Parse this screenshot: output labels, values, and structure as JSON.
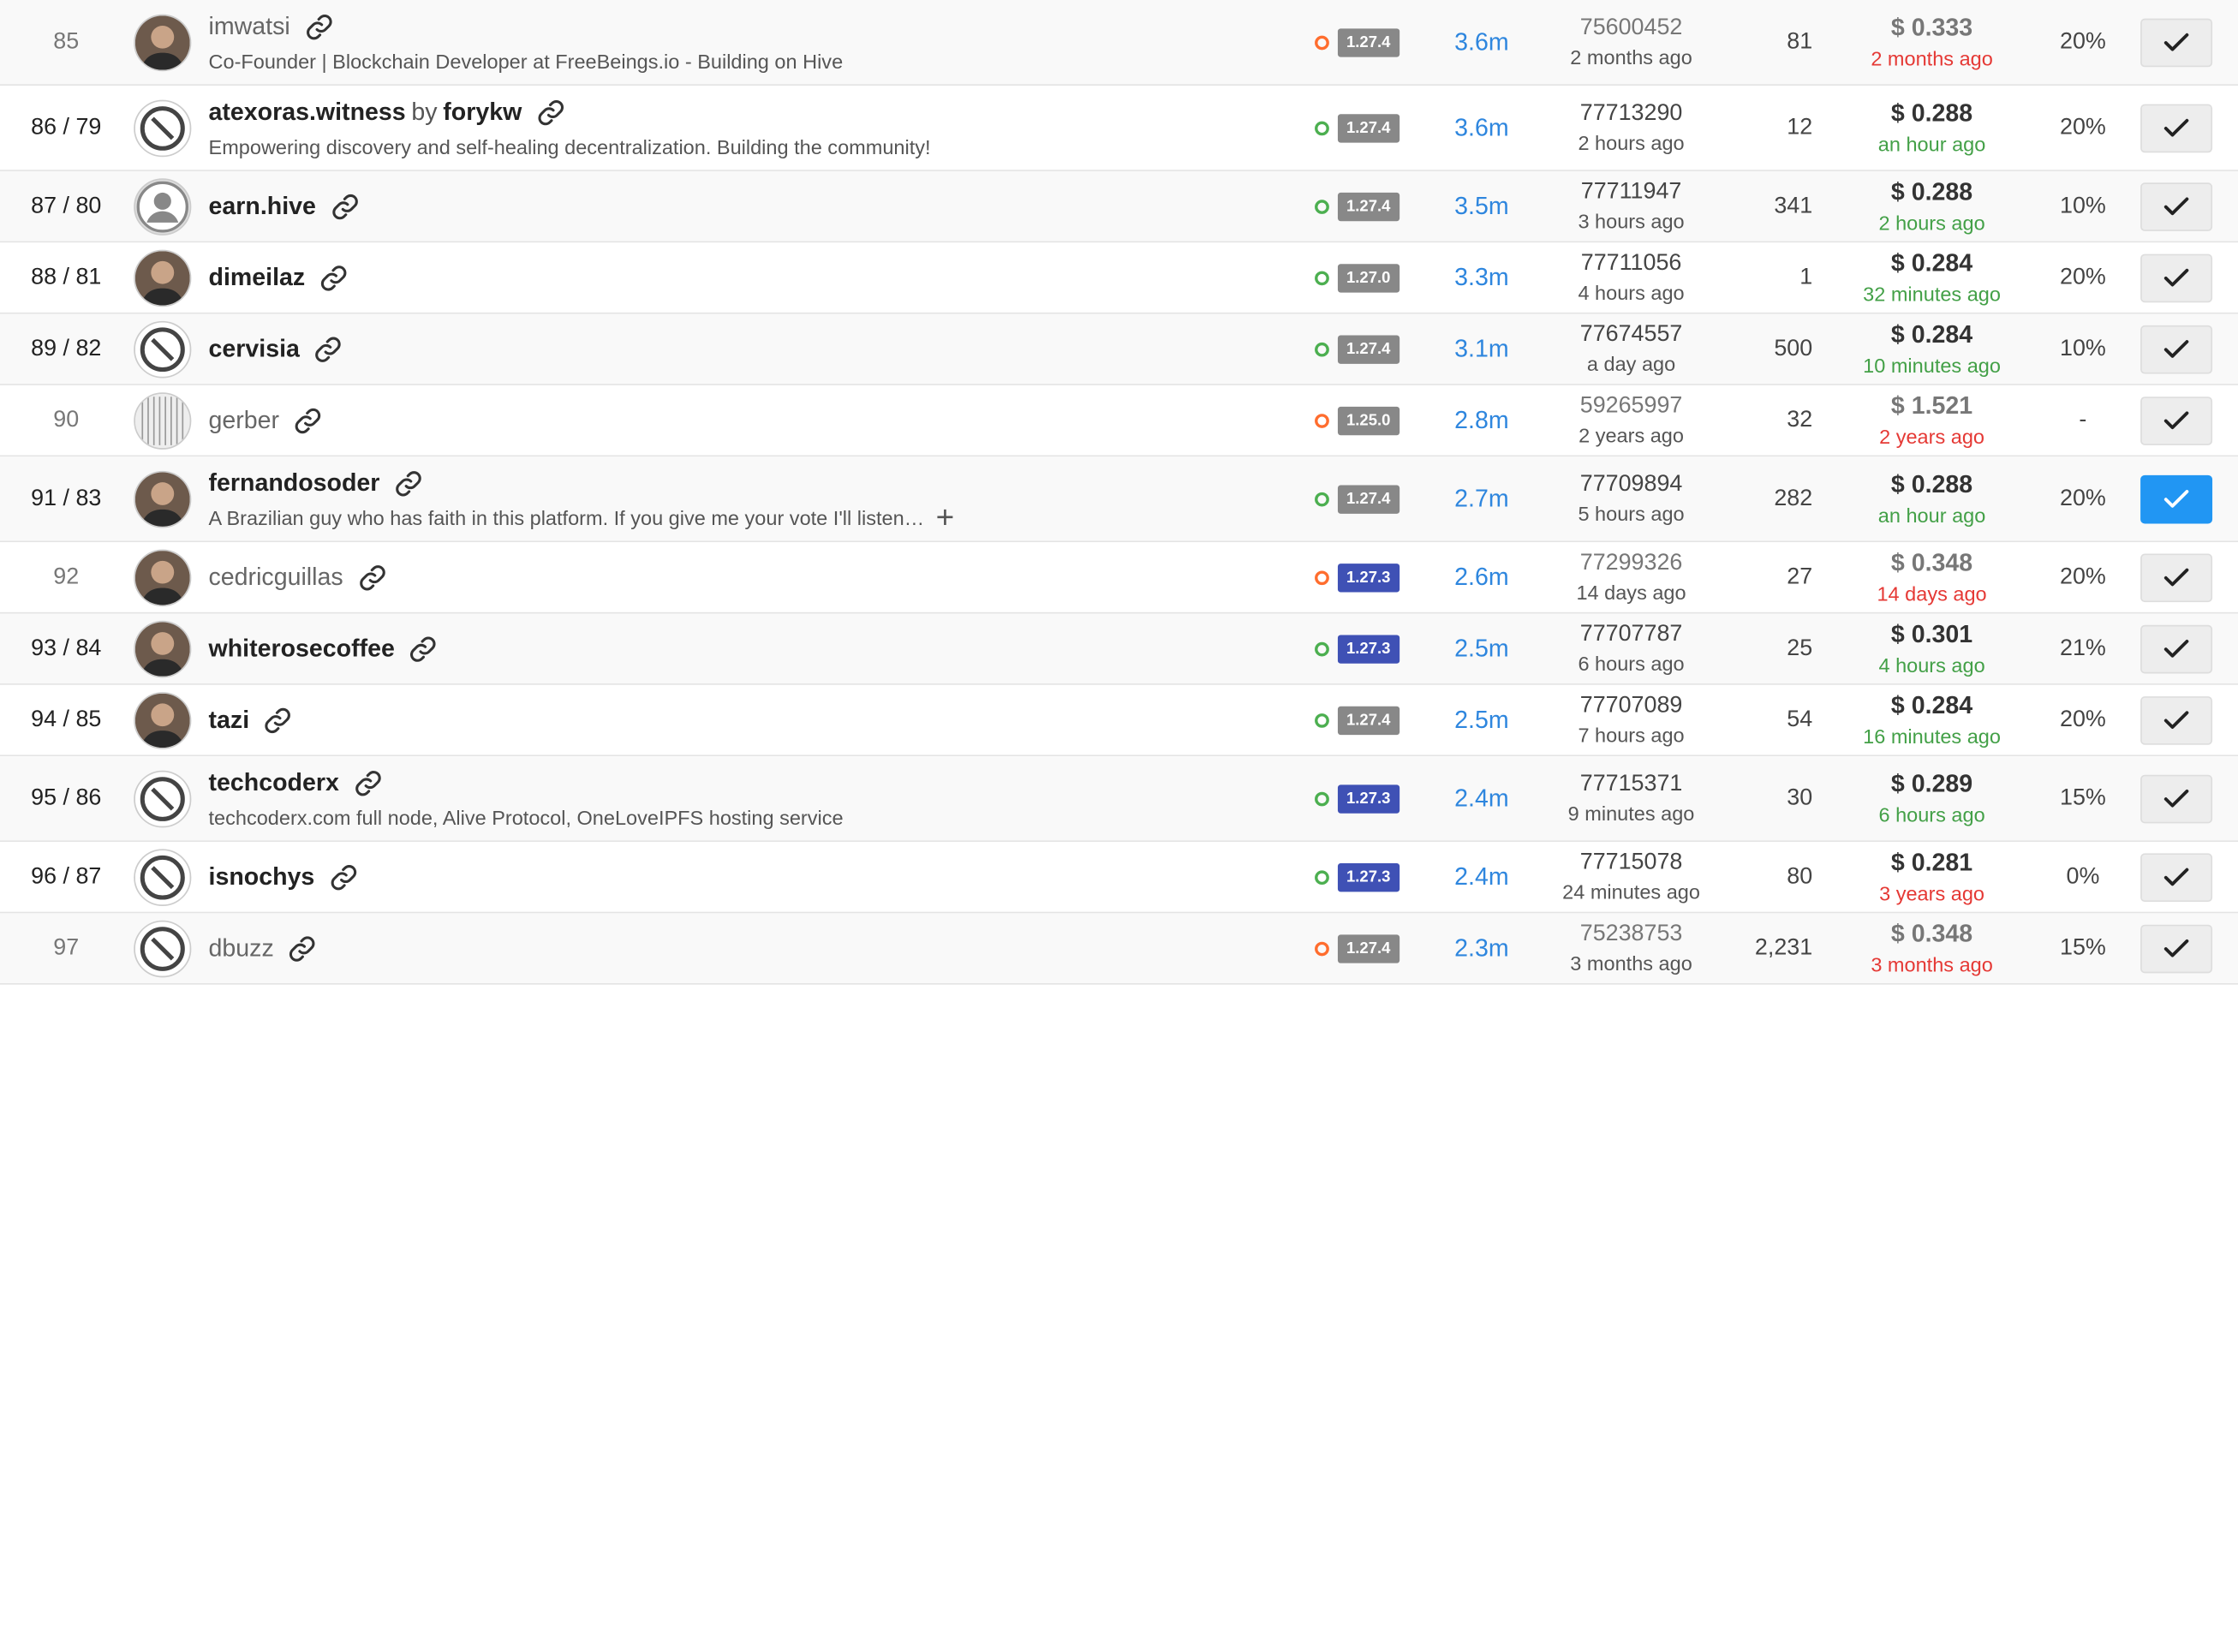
{
  "colors": {
    "accent_blue": "#2196f3",
    "votes_blue": "#2e86de",
    "active_dot": "#4caf50",
    "inactive_dot": "#ff6d2e",
    "version_gray": "#888888",
    "version_blue": "#3f51b5",
    "red": "#e53935",
    "green": "#43a047"
  },
  "rows": [
    {
      "rank": "85",
      "active": false,
      "avatar": "avatar-photo",
      "name": "imwatsi",
      "by": "",
      "by_name": "",
      "desc": "Co-Founder | Blockchain Developer at FreeBeings.io - Building on Hive",
      "desc_expand": false,
      "version": "1.27.4",
      "version_style": "gray",
      "votes": "3.6m",
      "block": "75600452",
      "block_time": "2 months ago",
      "missed": "81",
      "price": "$ 0.333",
      "price_time": "2 months ago",
      "price_color": "red",
      "apr": "20%",
      "voted": false,
      "tall": true
    },
    {
      "rank": "86 / 79",
      "active": true,
      "avatar": "avatar-logo",
      "name": "atexoras.witness",
      "by": "by",
      "by_name": "forykw",
      "desc": "Empowering discovery and self-healing decentralization. Building the community!",
      "desc_expand": false,
      "version": "1.27.4",
      "version_style": "gray",
      "votes": "3.6m",
      "block": "77713290",
      "block_time": "2 hours ago",
      "missed": "12",
      "price": "$ 0.288",
      "price_time": "an hour ago",
      "price_color": "green",
      "apr": "20%",
      "voted": false,
      "tall": true
    },
    {
      "rank": "87 / 80",
      "active": true,
      "avatar": "avatar-default",
      "name": "earn.hive",
      "by": "",
      "by_name": "",
      "desc": "",
      "desc_expand": false,
      "version": "1.27.4",
      "version_style": "gray",
      "votes": "3.5m",
      "block": "77711947",
      "block_time": "3 hours ago",
      "missed": "341",
      "price": "$ 0.288",
      "price_time": "2 hours ago",
      "price_color": "green",
      "apr": "10%",
      "voted": false,
      "tall": false
    },
    {
      "rank": "88 / 81",
      "active": true,
      "avatar": "avatar-photo",
      "name": "dimeilaz",
      "by": "",
      "by_name": "",
      "desc": "",
      "desc_expand": false,
      "version": "1.27.0",
      "version_style": "gray",
      "votes": "3.3m",
      "block": "77711056",
      "block_time": "4 hours ago",
      "missed": "1",
      "price": "$ 0.284",
      "price_time": "32 minutes ago",
      "price_color": "green",
      "apr": "20%",
      "voted": false,
      "tall": false
    },
    {
      "rank": "89 / 82",
      "active": true,
      "avatar": "avatar-logo",
      "name": "cervisia",
      "by": "",
      "by_name": "",
      "desc": "",
      "desc_expand": false,
      "version": "1.27.4",
      "version_style": "gray",
      "votes": "3.1m",
      "block": "77674557",
      "block_time": "a day ago",
      "missed": "500",
      "price": "$ 0.284",
      "price_time": "10 minutes ago",
      "price_color": "green",
      "apr": "10%",
      "voted": false,
      "tall": false
    },
    {
      "rank": "90",
      "active": false,
      "avatar": "avatar-pattern",
      "name": "gerber",
      "by": "",
      "by_name": "",
      "desc": "",
      "desc_expand": false,
      "version": "1.25.0",
      "version_style": "gray",
      "votes": "2.8m",
      "block": "59265997",
      "block_time": "2 years ago",
      "missed": "32",
      "price": "$ 1.521",
      "price_time": "2 years ago",
      "price_color": "red",
      "apr": "-",
      "voted": false,
      "tall": false
    },
    {
      "rank": "91 / 83",
      "active": true,
      "avatar": "avatar-photo",
      "name": "fernandosoder",
      "by": "",
      "by_name": "",
      "desc": "A Brazilian guy who has faith in this platform. If you give me your vote I'll listen…",
      "desc_expand": true,
      "version": "1.27.4",
      "version_style": "gray",
      "votes": "2.7m",
      "block": "77709894",
      "block_time": "5 hours ago",
      "missed": "282",
      "price": "$ 0.288",
      "price_time": "an hour ago",
      "price_color": "green",
      "apr": "20%",
      "voted": true,
      "tall": true
    },
    {
      "rank": "92",
      "active": false,
      "avatar": "avatar-photo",
      "name": "cedricguillas",
      "by": "",
      "by_name": "",
      "desc": "",
      "desc_expand": false,
      "version": "1.27.3",
      "version_style": "blue",
      "votes": "2.6m",
      "block": "77299326",
      "block_time": "14 days ago",
      "missed": "27",
      "price": "$ 0.348",
      "price_time": "14 days ago",
      "price_color": "red",
      "apr": "20%",
      "voted": false,
      "tall": false
    },
    {
      "rank": "93 / 84",
      "active": true,
      "avatar": "avatar-photo",
      "name": "whiterosecoffee",
      "by": "",
      "by_name": "",
      "desc": "",
      "desc_expand": false,
      "version": "1.27.3",
      "version_style": "blue",
      "votes": "2.5m",
      "block": "77707787",
      "block_time": "6 hours ago",
      "missed": "25",
      "price": "$ 0.301",
      "price_time": "4 hours ago",
      "price_color": "green",
      "apr": "21%",
      "voted": false,
      "tall": false
    },
    {
      "rank": "94 / 85",
      "active": true,
      "avatar": "avatar-photo",
      "name": "tazi",
      "by": "",
      "by_name": "",
      "desc": "",
      "desc_expand": false,
      "version": "1.27.4",
      "version_style": "gray",
      "votes": "2.5m",
      "block": "77707089",
      "block_time": "7 hours ago",
      "missed": "54",
      "price": "$ 0.284",
      "price_time": "16 minutes ago",
      "price_color": "green",
      "apr": "20%",
      "voted": false,
      "tall": false
    },
    {
      "rank": "95 / 86",
      "active": true,
      "avatar": "avatar-logo",
      "name": "techcoderx",
      "by": "",
      "by_name": "",
      "desc": "techcoderx.com full node, Alive Protocol, OneLoveIPFS hosting service",
      "desc_expand": false,
      "version": "1.27.3",
      "version_style": "blue",
      "votes": "2.4m",
      "block": "77715371",
      "block_time": "9 minutes ago",
      "missed": "30",
      "price": "$ 0.289",
      "price_time": "6 hours ago",
      "price_color": "green",
      "apr": "15%",
      "voted": false,
      "tall": true
    },
    {
      "rank": "96 / 87",
      "active": true,
      "avatar": "avatar-logo",
      "name": "isnochys",
      "by": "",
      "by_name": "",
      "desc": "",
      "desc_expand": false,
      "version": "1.27.3",
      "version_style": "blue",
      "votes": "2.4m",
      "block": "77715078",
      "block_time": "24 minutes ago",
      "missed": "80",
      "price": "$ 0.281",
      "price_time": "3 years ago",
      "price_color": "red",
      "apr": "0%",
      "voted": false,
      "tall": false
    },
    {
      "rank": "97",
      "active": false,
      "avatar": "avatar-logo",
      "name": "dbuzz",
      "by": "",
      "by_name": "",
      "desc": "",
      "desc_expand": false,
      "version": "1.27.4",
      "version_style": "gray",
      "votes": "2.3m",
      "block": "75238753",
      "block_time": "3 months ago",
      "missed": "2,231",
      "price": "$ 0.348",
      "price_time": "3 months ago",
      "price_color": "red",
      "apr": "15%",
      "voted": false,
      "tall": false
    }
  ]
}
